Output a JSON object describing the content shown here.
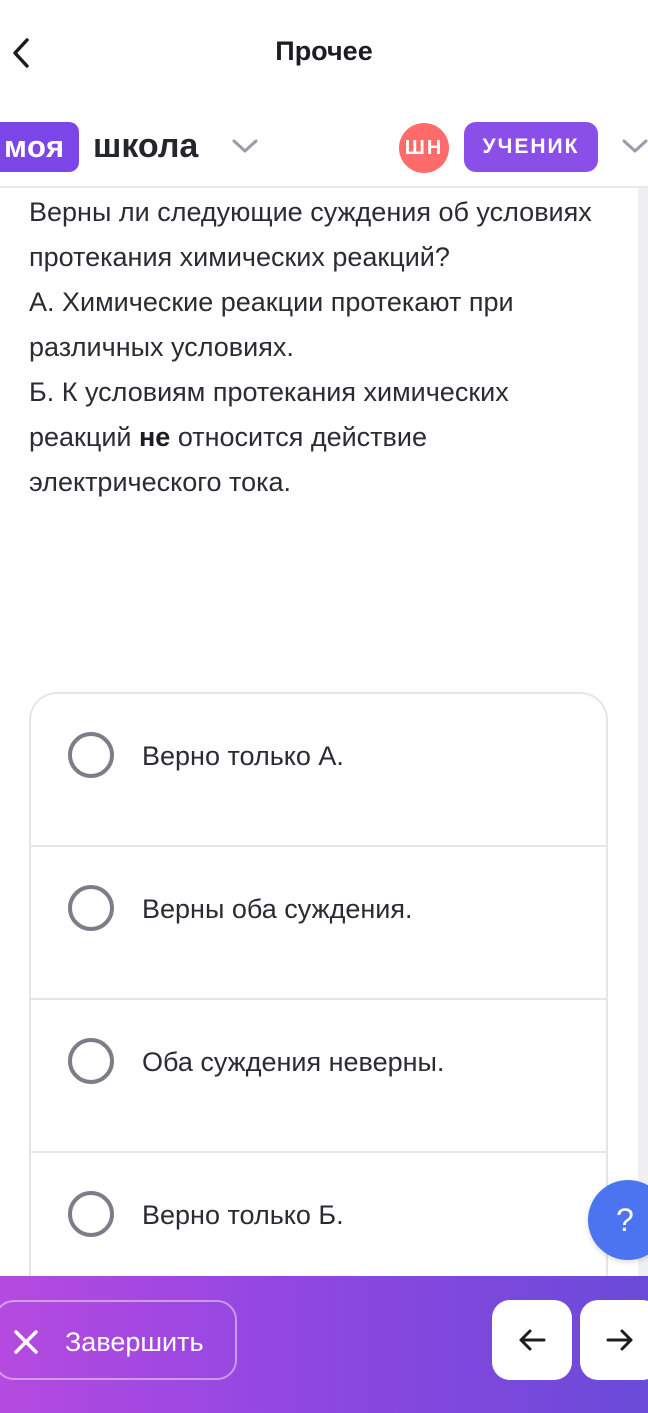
{
  "header": {
    "title": "Прочее"
  },
  "brand": {
    "moya": "моя",
    "shkola": "школа",
    "avatar_initials": "ШН",
    "role": "УЧЕНИК"
  },
  "question": {
    "line_intro": "Верны ли следующие суждения об условиях протекания химических реакций?",
    "line_a": "А. Химические реакции протекают при различных условиях.",
    "line_b_start": "Б. К условиям протекания химических реакций ",
    "line_b_bold": "не",
    "line_b_end": " относится действие электрического тока."
  },
  "answers": [
    {
      "label": "Верно только А."
    },
    {
      "label": "Верны оба суждения."
    },
    {
      "label": "Оба суждения неверны."
    },
    {
      "label": "Верно только Б."
    }
  ],
  "help": {
    "label": "?"
  },
  "footer": {
    "finish_label": "Завершить"
  },
  "colors": {
    "accent_purple": "#7b45e8",
    "avatar_red": "#ff6a6a",
    "help_blue": "#4d74f0",
    "footer_gradient_start": "#b54ae0",
    "footer_gradient_end": "#6a4ad8"
  },
  "icons": {
    "back": "chevron-left-icon",
    "brand_dropdown": "chevron-down-icon",
    "role_dropdown": "chevron-down-icon",
    "finish": "close-icon",
    "prev": "arrow-left-icon",
    "next": "arrow-right-icon"
  }
}
